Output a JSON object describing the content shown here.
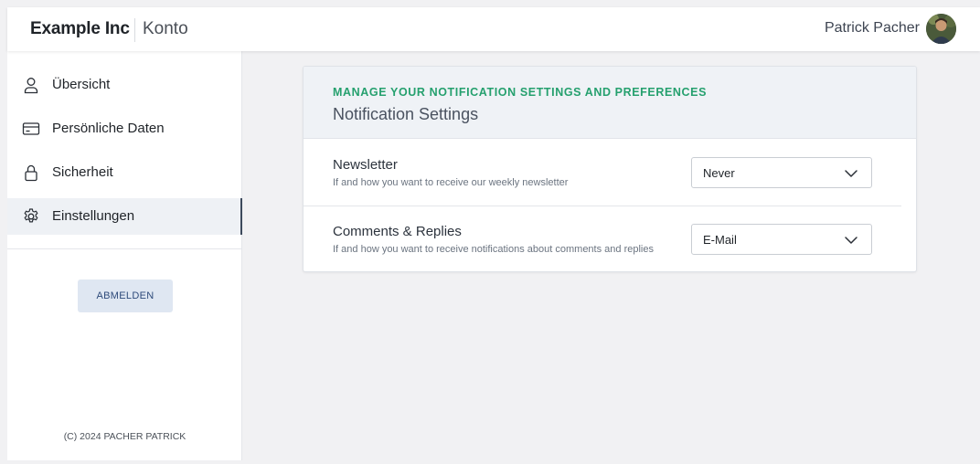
{
  "header": {
    "brand": "Example Inc",
    "section": "Konto",
    "user_name": "Patrick Pacher"
  },
  "sidebar": {
    "items": [
      {
        "label": "Übersicht",
        "icon": "user-icon",
        "active": false
      },
      {
        "label": "Persönliche Daten",
        "icon": "credit-card-icon",
        "active": false
      },
      {
        "label": "Sicherheit",
        "icon": "lock-icon",
        "active": false
      },
      {
        "label": "Einstellungen",
        "icon": "gear-icon",
        "active": true
      }
    ],
    "logout_label": "ABMELDEN",
    "copyright": "(C) 2024 PACHER PATRICK"
  },
  "card": {
    "eyebrow": "MANAGE YOUR NOTIFICATION SETTINGS AND PREFERENCES",
    "title": "Notification Settings",
    "rows": [
      {
        "title": "Newsletter",
        "description": "If and how you want to receive our weekly newsletter",
        "selected": "Never"
      },
      {
        "title": "Comments & Replies",
        "description": "If and how you want to receive notifications about comments and replies",
        "selected": "E-Mail"
      }
    ]
  },
  "colors": {
    "accent_green": "#25a06e",
    "active_bg": "#eef1f5",
    "logout_bg": "#dfe7f2",
    "page_bg": "#f1f1f3"
  }
}
